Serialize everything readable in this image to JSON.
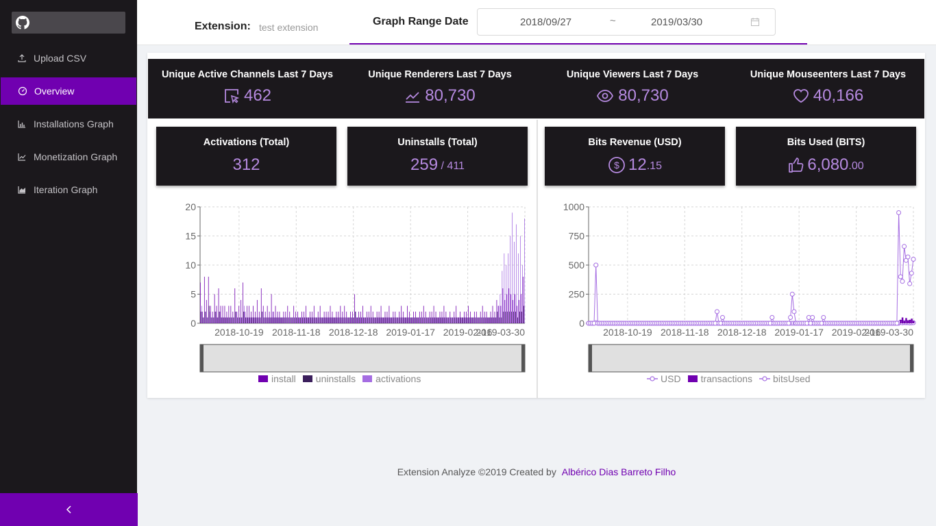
{
  "sidebar": {
    "items": [
      {
        "label": "Upload CSV",
        "icon": "upload-icon"
      },
      {
        "label": "Overview",
        "icon": "dashboard-icon",
        "active": true
      },
      {
        "label": "Installations Graph",
        "icon": "bar-chart-icon"
      },
      {
        "label": "Monetization Graph",
        "icon": "line-chart-icon"
      },
      {
        "label": "Iteration Graph",
        "icon": "area-chart-icon"
      }
    ],
    "logo_icon": "github-icon",
    "collapse_icon": "chevron-left-icon"
  },
  "header": {
    "extension_label": "Extension:",
    "extension_value": "test extension",
    "range_label": "Graph Range Date",
    "range_start": "2018/09/27",
    "range_separator": "~",
    "range_end": "2019/03/30"
  },
  "top_stats": [
    {
      "title": "Unique Active Channels Last 7 Days",
      "value": "462",
      "icon": "pointer-box-icon"
    },
    {
      "title": "Unique Renderers Last 7 Days",
      "value": "80,730",
      "icon": "line-chart-icon"
    },
    {
      "title": "Unique Viewers Last 7 Days",
      "value": "80,730",
      "icon": "eye-icon"
    },
    {
      "title": "Unique Mouseenters Last 7 Days",
      "value": "40,166",
      "icon": "heart-icon"
    }
  ],
  "boxes": {
    "activations": {
      "title": "Activations (Total)",
      "value": "312"
    },
    "uninstalls": {
      "title": "Uninstalls (Total)",
      "value": "259",
      "total": " / 411"
    },
    "bits_revenue": {
      "title": "Bits Revenue (USD)",
      "value": "12",
      "decimals": ".15",
      "icon": "dollar-icon"
    },
    "bits_used": {
      "title": "Bits Used (BITS)",
      "value": "6,080",
      "decimals": ".00",
      "icon": "thumbs-up-icon"
    }
  },
  "colors": {
    "accent": "#7000b0",
    "value": "#b68ae0",
    "dark": "#1b181c"
  },
  "chart_data": [
    {
      "type": "bar",
      "x_ticks": [
        "2018-10-19",
        "2018-11-18",
        "2018-12-18",
        "2019-01-17",
        "2019-02-16",
        "2019-03-30"
      ],
      "y_ticks": [
        "0",
        "5",
        "10",
        "15",
        "20"
      ],
      "ylim": [
        0,
        20
      ],
      "grid": true,
      "legend_position": "bottom",
      "series": [
        {
          "name": "install",
          "color": "#7000b0",
          "values": [
            7,
            2,
            8,
            4,
            8,
            3,
            2,
            5,
            3,
            6,
            3,
            3,
            3,
            2,
            3,
            3,
            2,
            6,
            2,
            3,
            4,
            7,
            2,
            3,
            3,
            2,
            3,
            2,
            4,
            2,
            6,
            3,
            2,
            3,
            2,
            5,
            2,
            3,
            2,
            2,
            1,
            2,
            2,
            3,
            2,
            1,
            3,
            2,
            2,
            1,
            2,
            2,
            3,
            1,
            2,
            2,
            3,
            1,
            2,
            3,
            1,
            2,
            2,
            2,
            3,
            2,
            1,
            2,
            2,
            3,
            2,
            3,
            2,
            1,
            2,
            2,
            5,
            1,
            2,
            2,
            3,
            1,
            2,
            2,
            3,
            2,
            1,
            2,
            2,
            3,
            1,
            2,
            2,
            3,
            1,
            2,
            2,
            1,
            2,
            3,
            2,
            1,
            3,
            2,
            1,
            2,
            2,
            1,
            2,
            2,
            3,
            2,
            1,
            2,
            2,
            3,
            2,
            1,
            2,
            2,
            3,
            2,
            1,
            2,
            1,
            2,
            3,
            1,
            2,
            1,
            2,
            2,
            3,
            2,
            1,
            2,
            2,
            1,
            2,
            3,
            2,
            2,
            1,
            2,
            3,
            2,
            4,
            3,
            3,
            6,
            4,
            5,
            6,
            5,
            4,
            5,
            3,
            4,
            5,
            8
          ]
        },
        {
          "name": "uninstalls",
          "color": "#3b1f5c",
          "values": [
            2,
            1,
            2,
            1,
            3,
            1,
            1,
            2,
            1,
            2,
            1,
            1,
            1,
            1,
            1,
            1,
            1,
            2,
            1,
            1,
            1,
            2,
            1,
            1,
            1,
            1,
            1,
            1,
            1,
            1,
            2,
            1,
            1,
            1,
            1,
            1,
            1,
            1,
            1,
            1,
            1,
            1,
            1,
            1,
            1,
            1,
            1,
            1,
            1,
            1,
            1,
            1,
            1,
            1,
            1,
            1,
            1,
            1,
            1,
            1,
            1,
            1,
            1,
            1,
            1,
            1,
            1,
            1,
            1,
            1,
            1,
            1,
            1,
            1,
            1,
            1,
            2,
            1,
            1,
            1,
            1,
            1,
            1,
            1,
            1,
            1,
            1,
            1,
            1,
            1,
            1,
            1,
            1,
            1,
            1,
            1,
            1,
            1,
            1,
            1,
            1,
            1,
            1,
            1,
            1,
            1,
            1,
            1,
            1,
            1,
            1,
            1,
            1,
            1,
            1,
            1,
            1,
            1,
            1,
            1,
            1,
            1,
            1,
            1,
            1,
            1,
            1,
            1,
            1,
            1,
            1,
            1,
            1,
            1,
            1,
            1,
            1,
            1,
            1,
            1,
            1,
            1,
            1,
            1,
            1,
            1,
            2,
            1,
            1,
            2,
            2,
            2,
            2,
            2,
            2,
            2,
            1,
            2,
            2,
            3
          ]
        },
        {
          "name": "activations",
          "color": "#a56de2",
          "values": [
            3,
            1,
            2,
            1,
            2,
            1,
            1,
            2,
            1,
            2,
            1,
            1,
            1,
            1,
            1,
            1,
            1,
            2,
            1,
            1,
            1,
            3,
            1,
            1,
            1,
            1,
            1,
            1,
            1,
            1,
            2,
            1,
            1,
            1,
            1,
            2,
            1,
            1,
            1,
            1,
            1,
            1,
            1,
            1,
            1,
            1,
            1,
            1,
            1,
            1,
            1,
            1,
            1,
            1,
            1,
            1,
            1,
            1,
            1,
            1,
            1,
            1,
            1,
            1,
            1,
            1,
            1,
            1,
            1,
            1,
            1,
            1,
            1,
            1,
            1,
            1,
            2,
            1,
            1,
            1,
            1,
            1,
            1,
            1,
            1,
            1,
            1,
            1,
            1,
            1,
            1,
            1,
            1,
            1,
            1,
            1,
            1,
            1,
            1,
            1,
            1,
            1,
            1,
            1,
            1,
            1,
            1,
            1,
            1,
            1,
            1,
            1,
            1,
            1,
            1,
            1,
            1,
            1,
            1,
            1,
            1,
            1,
            1,
            1,
            1,
            1,
            1,
            1,
            1,
            1,
            1,
            1,
            1,
            1,
            1,
            1,
            1,
            1,
            1,
            1,
            1,
            1,
            1,
            1,
            1,
            1,
            3,
            5,
            9,
            12,
            10,
            12,
            15,
            19,
            14,
            17,
            12,
            15,
            10,
            18
          ]
        }
      ]
    },
    {
      "type": "line",
      "x_ticks": [
        "2018-10-19",
        "2018-11-18",
        "2018-12-18",
        "2019-01-17",
        "2019-02-16",
        "2019-03-30"
      ],
      "y_ticks": [
        "0",
        "250",
        "500",
        "750",
        "1000"
      ],
      "ylim": [
        0,
        1000
      ],
      "grid": true,
      "legend_position": "bottom",
      "series": [
        {
          "name": "USD",
          "color": "#a56de2",
          "values": [
            0,
            0,
            0,
            0,
            5,
            0,
            0,
            0,
            0,
            0,
            0,
            0,
            0,
            0,
            0,
            0,
            0,
            0,
            0,
            0,
            0,
            0,
            0,
            0,
            0,
            0,
            0,
            0,
            0,
            0,
            0,
            0,
            0,
            0,
            0,
            0,
            0,
            0,
            0,
            0,
            0,
            0,
            0,
            0,
            0,
            0,
            0,
            0,
            0,
            0,
            0,
            0,
            0,
            0,
            0,
            0,
            0,
            0,
            0,
            0,
            0,
            0,
            0,
            0,
            0,
            0,
            0,
            0,
            0,
            0,
            0,
            0,
            0,
            0,
            0,
            0,
            0,
            0,
            0,
            0,
            0,
            0,
            0,
            0,
            0,
            0,
            0,
            0,
            0,
            0,
            0,
            0,
            0,
            0,
            0,
            0,
            0,
            0,
            0,
            0,
            0,
            0,
            0,
            0,
            0,
            0,
            0,
            0,
            0,
            0,
            0,
            0,
            0,
            0,
            0,
            0,
            0,
            0,
            0,
            0,
            0,
            0,
            0,
            0,
            0,
            0,
            0,
            0,
            0,
            0,
            0,
            0,
            0,
            0,
            0,
            0,
            0,
            0,
            0,
            0,
            0,
            0,
            0,
            0,
            0,
            0,
            0,
            0,
            0,
            0,
            0,
            0,
            0,
            0,
            0,
            0,
            0,
            0,
            0,
            0,
            0,
            0,
            0,
            0,
            0,
            0,
            0,
            0,
            0,
            9,
            4,
            6,
            5,
            5,
            3,
            4,
            5
          ]
        },
        {
          "name": "transactions",
          "color": "#7000b0",
          "values": [
            0,
            0,
            0,
            0,
            0,
            0,
            0,
            0,
            0,
            0,
            0,
            0,
            0,
            0,
            0,
            0,
            0,
            0,
            0,
            0,
            0,
            0,
            0,
            0,
            0,
            0,
            0,
            0,
            0,
            0,
            0,
            0,
            0,
            0,
            0,
            0,
            0,
            0,
            0,
            0,
            0,
            0,
            0,
            0,
            0,
            0,
            0,
            0,
            0,
            0,
            0,
            0,
            0,
            0,
            0,
            0,
            0,
            0,
            0,
            0,
            0,
            0,
            0,
            0,
            0,
            0,
            0,
            0,
            0,
            0,
            0,
            0,
            0,
            0,
            0,
            0,
            0,
            0,
            0,
            0,
            0,
            0,
            0,
            0,
            0,
            0,
            0,
            0,
            0,
            0,
            0,
            0,
            0,
            0,
            0,
            0,
            0,
            0,
            0,
            0,
            0,
            0,
            0,
            0,
            0,
            0,
            0,
            0,
            0,
            0,
            0,
            0,
            0,
            0,
            0,
            0,
            0,
            0,
            0,
            0,
            0,
            0,
            0,
            0,
            0,
            0,
            0,
            0,
            0,
            0,
            0,
            0,
            0,
            0,
            0,
            0,
            0,
            0,
            0,
            0,
            0,
            0,
            0,
            0,
            0,
            0,
            0,
            0,
            0,
            0,
            0,
            0,
            0,
            0,
            0,
            0,
            0,
            0,
            0,
            0,
            0,
            0,
            0,
            0,
            0,
            0,
            0,
            0,
            0,
            30,
            50,
            20,
            45,
            25,
            30,
            40,
            20
          ]
        },
        {
          "name": "bitsUsed",
          "color": "#a56de2",
          "values": [
            0,
            0,
            0,
            0,
            500,
            0,
            0,
            0,
            0,
            0,
            0,
            0,
            0,
            0,
            0,
            0,
            0,
            0,
            0,
            0,
            0,
            0,
            0,
            0,
            0,
            0,
            0,
            0,
            0,
            0,
            0,
            0,
            0,
            0,
            0,
            0,
            0,
            0,
            0,
            0,
            0,
            0,
            0,
            0,
            0,
            0,
            0,
            0,
            0,
            0,
            0,
            0,
            0,
            0,
            0,
            0,
            0,
            0,
            0,
            0,
            0,
            0,
            0,
            0,
            0,
            0,
            0,
            0,
            0,
            0,
            100,
            0,
            0,
            50,
            0,
            0,
            0,
            0,
            0,
            0,
            0,
            0,
            0,
            0,
            0,
            0,
            0,
            0,
            0,
            0,
            0,
            0,
            0,
            0,
            0,
            0,
            0,
            0,
            0,
            0,
            50,
            0,
            0,
            0,
            0,
            0,
            0,
            0,
            0,
            0,
            50,
            250,
            100,
            0,
            0,
            0,
            0,
            0,
            0,
            0,
            50,
            0,
            50,
            0,
            0,
            0,
            0,
            0,
            50,
            0,
            0,
            0,
            0,
            0,
            0,
            0,
            0,
            0,
            0,
            0,
            0,
            0,
            0,
            0,
            0,
            0,
            0,
            0,
            0,
            0,
            0,
            0,
            0,
            0,
            0,
            0,
            0,
            0,
            0,
            0,
            0,
            0,
            0,
            0,
            0,
            0,
            0,
            0,
            0,
            950,
            400,
            360,
            660,
            540,
            570,
            340,
            430,
            550
          ]
        }
      ]
    }
  ],
  "footer": {
    "text": "Extension Analyze ©2019 Created by",
    "author": "Albérico Dias Barreto Filho"
  }
}
